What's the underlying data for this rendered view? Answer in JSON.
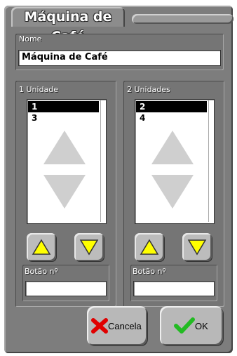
{
  "window": {
    "title": "Máquina de Café"
  },
  "name_field": {
    "label": "Nome",
    "value": "Máquina de Café"
  },
  "left_group": {
    "label": "1 Unidade",
    "items": [
      "1",
      "3"
    ],
    "selected_index": 0,
    "button_label": "Botão nº",
    "button_value": ""
  },
  "right_group": {
    "label": "2 Unidades",
    "items": [
      "2",
      "4"
    ],
    "selected_index": 0,
    "button_label": "Botão nº",
    "button_value": ""
  },
  "buttons": {
    "cancel": "Cancela",
    "ok": "OK"
  },
  "icons": {
    "up": "triangle-up-icon",
    "down": "triangle-down-icon",
    "cancel": "red-x-icon",
    "ok": "green-check-icon"
  },
  "colors": {
    "arrow_yellow": "#ffff00",
    "cancel_red": "#e00000",
    "ok_green": "#22bb22"
  }
}
